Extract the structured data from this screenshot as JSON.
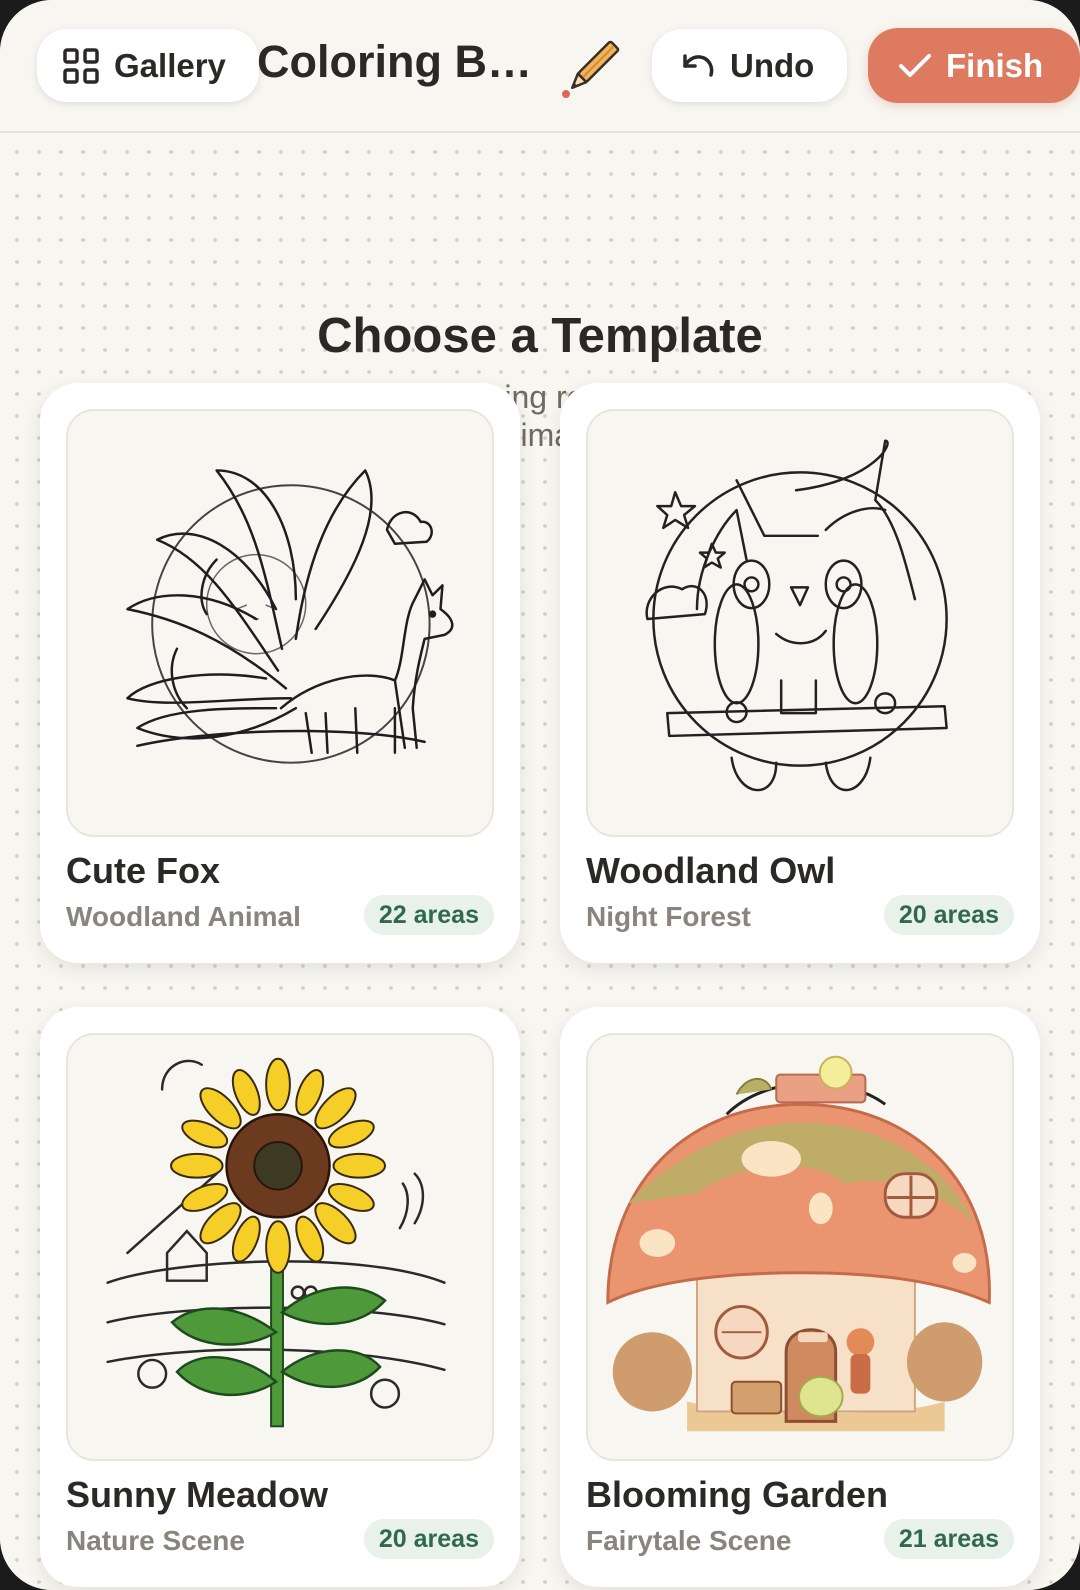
{
  "header": {
    "gallery_label": "Gallery",
    "title": "Coloring B…",
    "undo_label": "Undo",
    "finish_label": "Finish",
    "finish_color": "#de7a60"
  },
  "main": {
    "heading": "Choose a Template",
    "subheading": "Tap an illustration to start coloring relaxing nature scenes and cute animals"
  },
  "templates": [
    {
      "title": "Cute Fox",
      "category": "Woodland Animal",
      "areas": "22 areas",
      "image": "fox-illustration"
    },
    {
      "title": "Woodland Owl",
      "category": "Night Forest",
      "areas": "20 areas",
      "image": "owl-illustration"
    },
    {
      "title": "Sunny Meadow",
      "category": "Nature Scene",
      "areas": "20 areas",
      "image": "sunflower-illustration"
    },
    {
      "title": "Blooming Garden",
      "category": "Fairytale Scene",
      "areas": "21 areas",
      "image": "mushroom-house-illustration"
    }
  ]
}
